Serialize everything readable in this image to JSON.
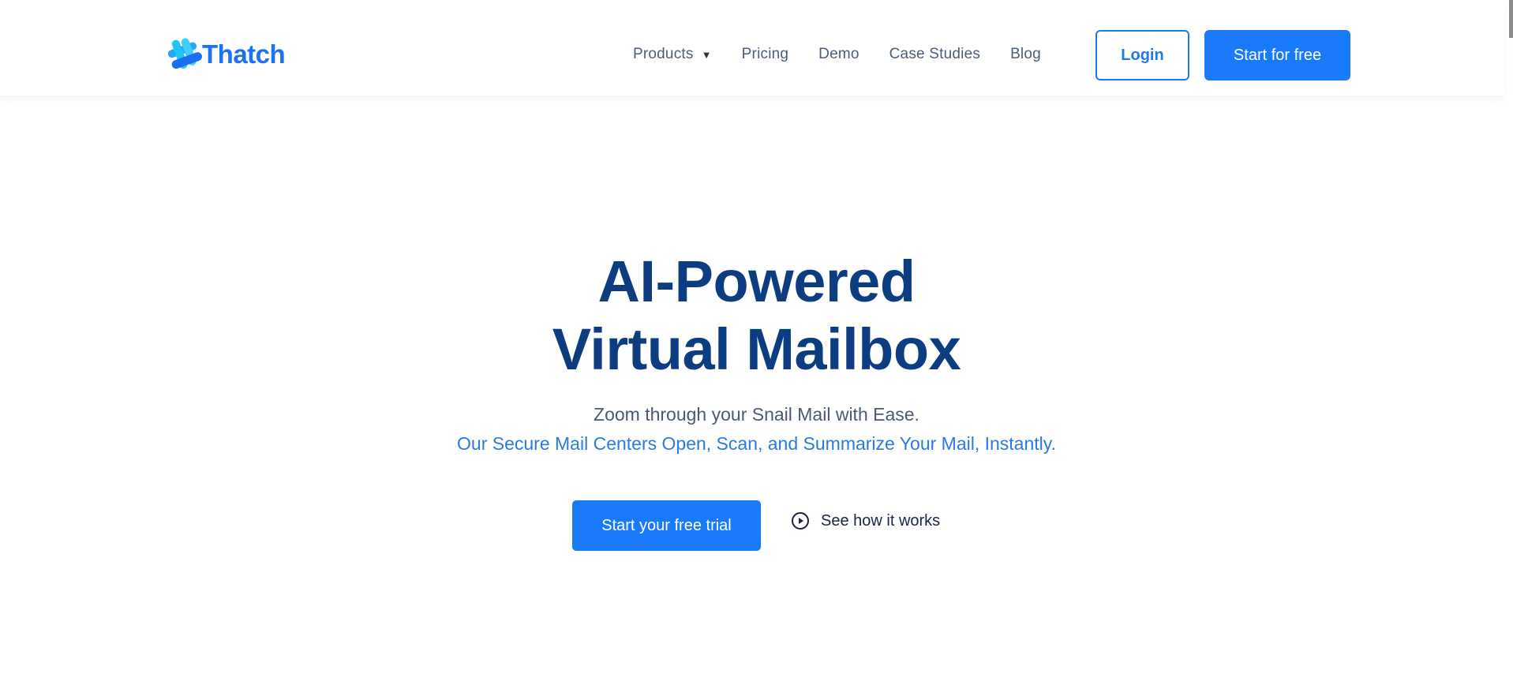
{
  "brand": {
    "name": "Thatch",
    "logo_icon": "thatch-logo-icon",
    "colors": {
      "primary": "#1a7bfa",
      "heading": "#0c3d80",
      "nav_text": "#4a5d7a",
      "accent_text": "#2a7be0"
    }
  },
  "nav": {
    "items": [
      {
        "label": "Products",
        "has_dropdown": true,
        "icon": "caret-down-icon"
      },
      {
        "label": "Pricing"
      },
      {
        "label": "Demo"
      },
      {
        "label": "Case Studies"
      },
      {
        "label": "Blog"
      }
    ],
    "login_label": "Login",
    "start_label": "Start for free"
  },
  "hero": {
    "title_line1": "AI-Powered",
    "title_line2": "Virtual Mailbox",
    "subtitle1": "Zoom through your Snail Mail with Ease.",
    "subtitle2": "Our Secure Mail Centers Open, Scan, and Summarize Your Mail, Instantly.",
    "cta_primary": "Start your free trial",
    "cta_secondary": "See how it works",
    "cta_secondary_icon": "play-circle-icon"
  }
}
